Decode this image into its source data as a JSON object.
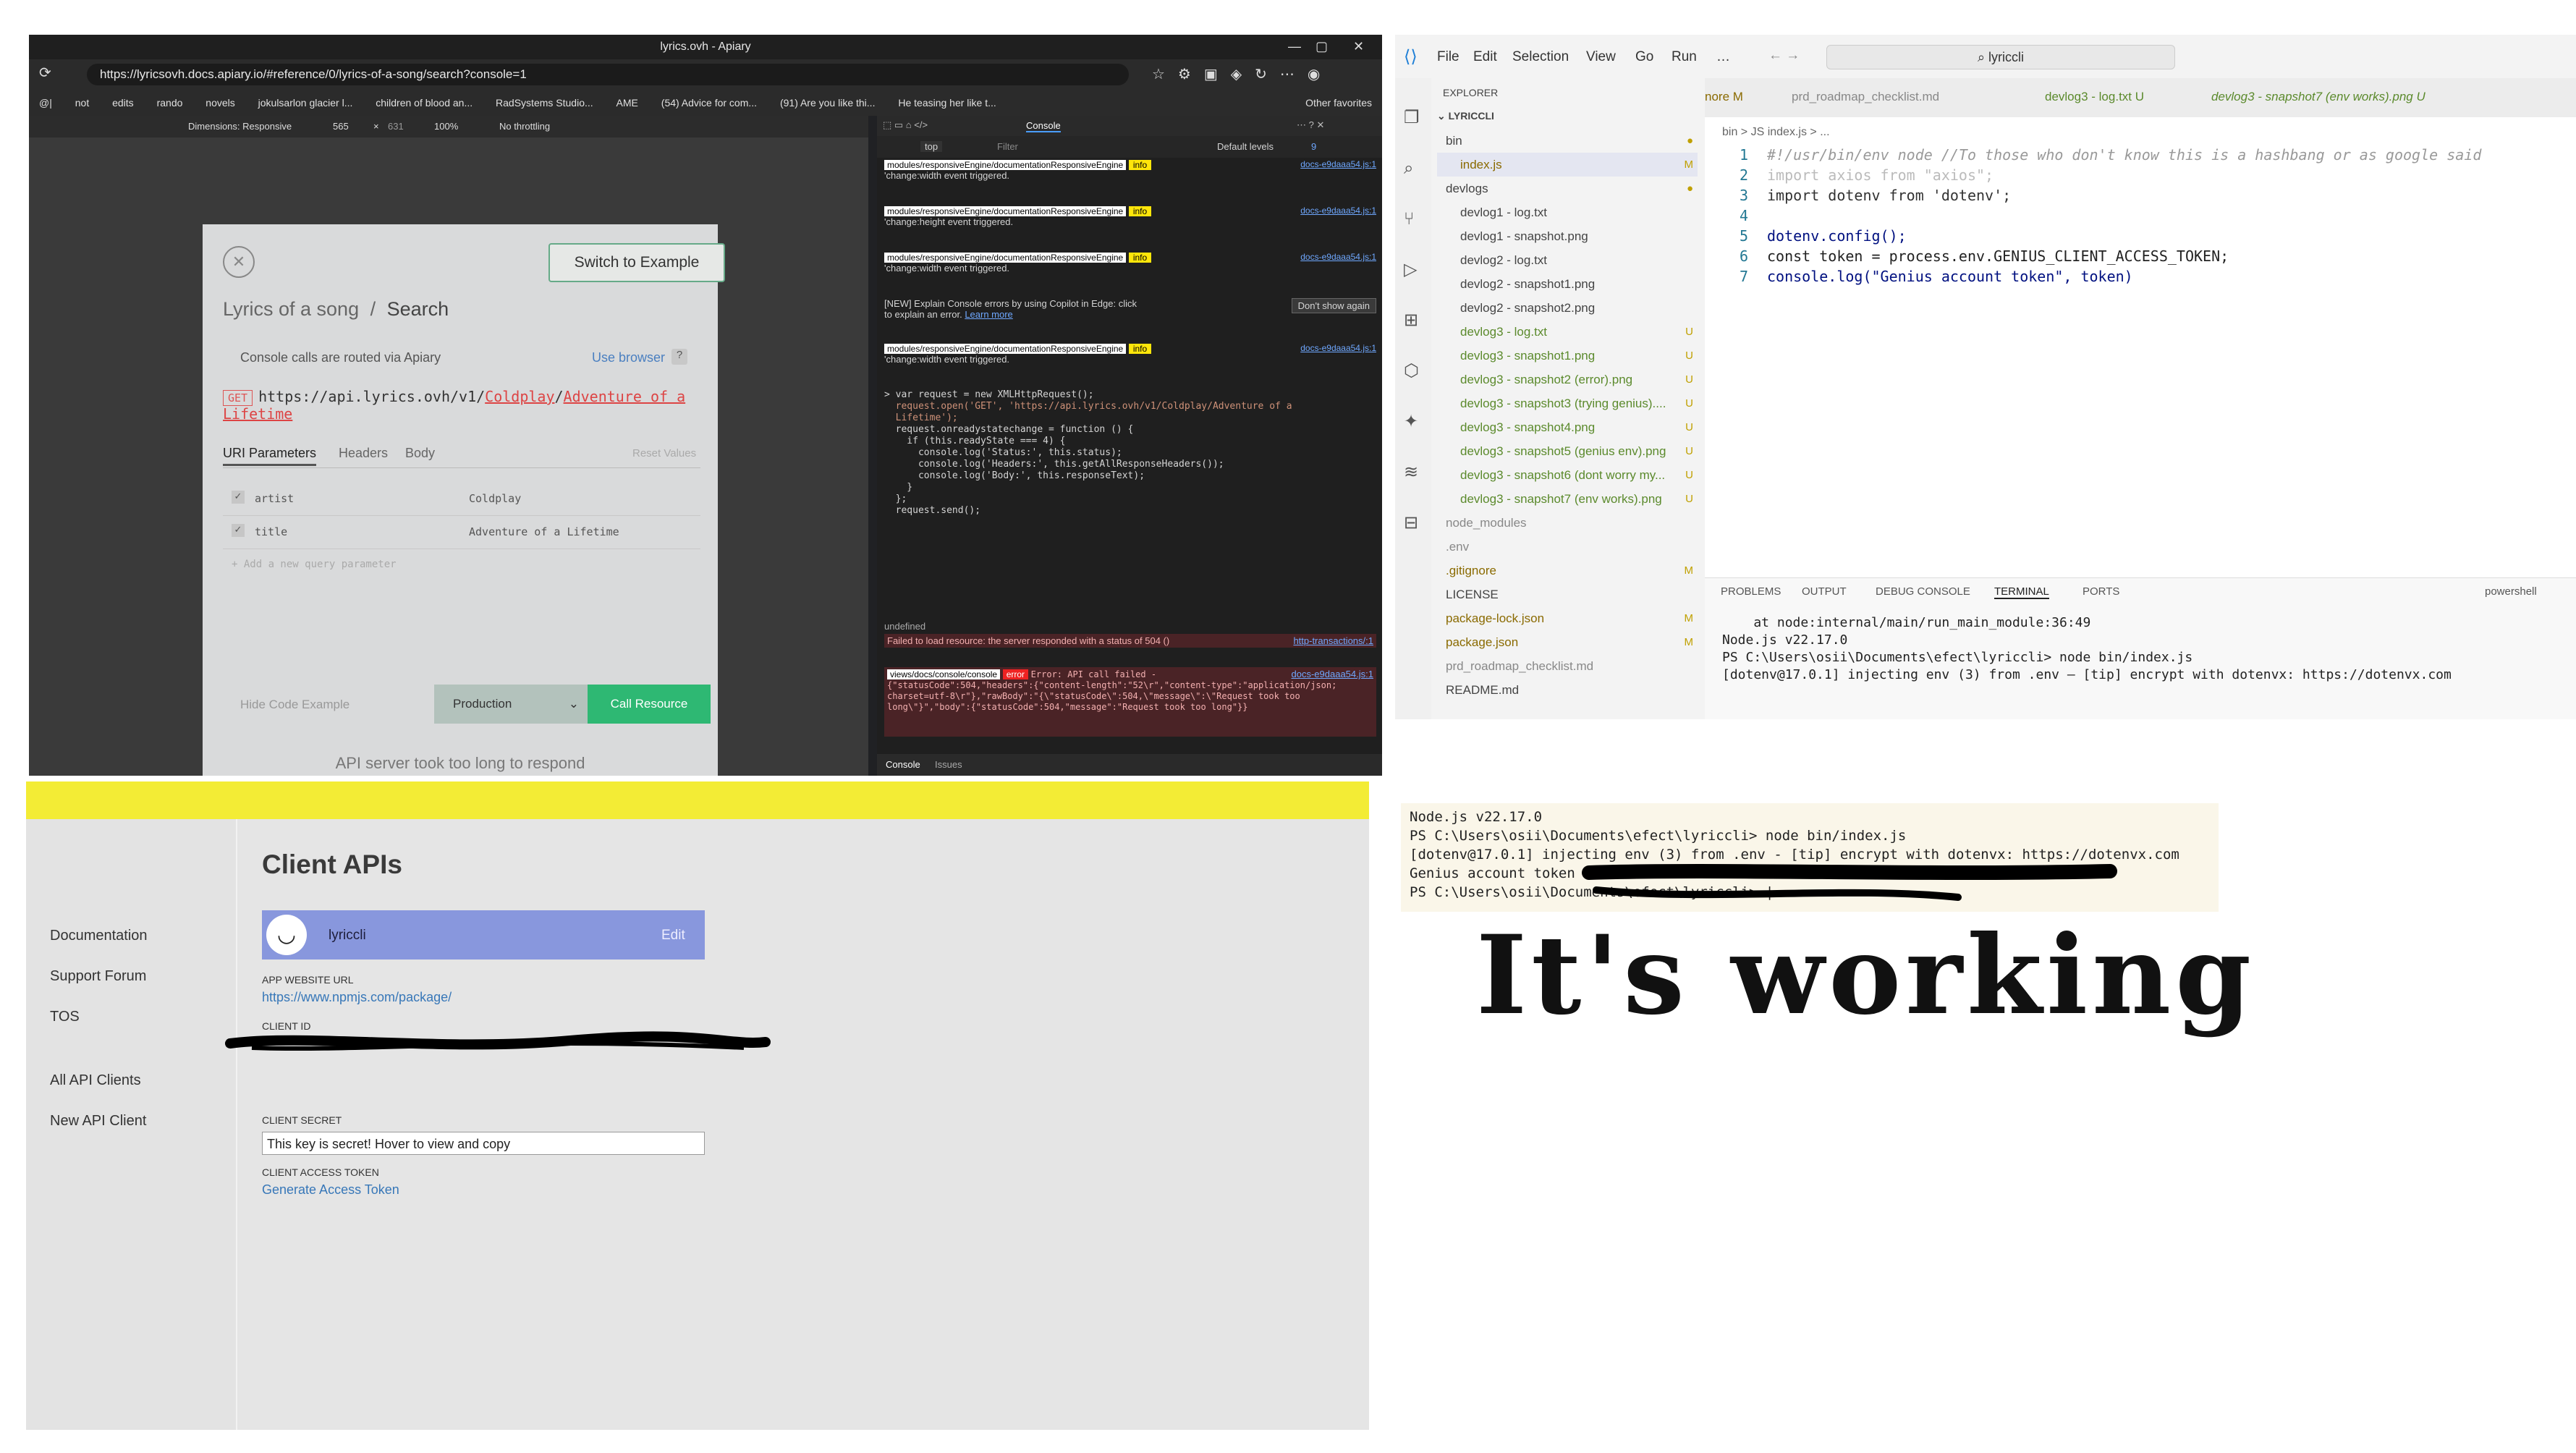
{
  "browser": {
    "window_title": "lyrics.ovh - Apiary",
    "url": "https://lyricsovh.docs.apiary.io/#reference/0/lyrics-of-a-song/search?console=1",
    "bookmarks": [
      "@|",
      "not",
      "edits",
      "rando",
      "novels",
      "jokulsarlon glacier l...",
      "children of blood an...",
      "RadSystems Studio...",
      "AME",
      "(54) Advice for com...",
      "(91) Are you like thi...",
      "He teasing her like t..."
    ],
    "other_favorites": "Other favorites",
    "devtoolbar": {
      "dimensions": "Dimensions: Responsive",
      "width": "565",
      "x": "×",
      "height": "631",
      "zoom": "100%",
      "throttle": "No throttling"
    }
  },
  "apiary": {
    "switch_label": "Switch to Example",
    "crumb_1": "Lyrics of a song",
    "crumb_sep": "/",
    "crumb_2": "Search",
    "routed_text": "Console calls are routed via Apiary",
    "use_browser": "Use browser",
    "method": "GET",
    "url_prefix": "https://api.lyrics.ovh/v1/",
    "url_artist": "Coldplay",
    "url_sep": "/",
    "url_title": "Adventure of a Lifetime",
    "tab_uri": "URI Parameters",
    "tab_headers": "Headers",
    "tab_body": "Body",
    "reset": "Reset Values",
    "params": [
      {
        "name": "artist",
        "value": "Coldplay"
      },
      {
        "name": "title",
        "value": "Adventure of a Lifetime"
      }
    ],
    "add_param": "Add a new query parameter",
    "hide_code": "Hide Code Example",
    "environment": "Production",
    "call_resource": "Call Resource",
    "error_message": "API server took too long to respond"
  },
  "devtools": {
    "console_tab": "Console",
    "context": "top",
    "filter_placeholder": "Filter",
    "levels": "Default levels",
    "issues_count": "9",
    "tag": "modules/responsiveEngine/documentationResponsiveEngine",
    "info": "info",
    "src": "docs-e9daaa54.js:1",
    "logs": [
      "'change:width event triggered.",
      "'change:height event triggered.",
      "'change:width event triggered.",
      "'change:width event triggered."
    ],
    "new_notice": "[NEW] Explain Console errors by using Copilot in Edge: click",
    "new_notice_2": "to explain an error.",
    "learn_more": "Learn more",
    "dont_show": "Don't show again",
    "code_lines": [
      "> var request = new XMLHttpRequest();",
      "",
      "  request.open('GET', 'https://api.lyrics.ovh/v1/Coldplay/Adventure of a",
      "  Lifetime');",
      "",
      "  request.onreadystatechange = function () {",
      "    if (this.readyState === 4) {",
      "      console.log('Status:', this.status);",
      "      console.log('Headers:', this.getAllResponseHeaders());",
      "      console.log('Body:', this.responseText);",
      "    }",
      "  };",
      "",
      "  request.send();"
    ],
    "undefined": "undefined",
    "fail_text": "Failed to load resource: the server responded with a status of 504 ()",
    "fail_link": "http-transactions/:1",
    "console_tag": "views/docs/console/console",
    "error_label": "error",
    "error_text": "Error: API call failed - {\"statusCode\":504,\"headers\":{\"content-length\":\"52\\r\",\"content-type\":\"application/json; charset=utf-8\\r\"},\"rawBody\":\"{\\\"statusCode\\\":504,\\\"message\\\":\\\"Request took too long\\\"}\",\"body\":{\"statusCode\":504,\"message\":\"Request took too long\"}}",
    "bottom_console": "Console",
    "bottom_issues": "Issues"
  },
  "vscode": {
    "menu": [
      "File",
      "Edit",
      "Selection",
      "View",
      "Go",
      "Run",
      "…"
    ],
    "search": "lyriccli",
    "tabs": [
      "nore M",
      "prd_roadmap_checklist.md",
      "devlog3 - log.txt U",
      "devlog3 - snapshot7 (env works).png U"
    ],
    "explorer_title": "EXPLORER",
    "root": "LYRICCLI",
    "files": [
      {
        "name": "bin",
        "status": ""
      },
      {
        "name": "index.js",
        "status": "M"
      },
      {
        "name": "devlogs",
        "status": ""
      },
      {
        "name": "devlog1 - log.txt",
        "status": ""
      },
      {
        "name": "devlog1 - snapshot.png",
        "status": ""
      },
      {
        "name": "devlog2 - log.txt",
        "status": ""
      },
      {
        "name": "devlog2 - snapshot1.png",
        "status": ""
      },
      {
        "name": "devlog2 - snapshot2.png",
        "status": ""
      },
      {
        "name": "devlog3 - log.txt",
        "status": "U"
      },
      {
        "name": "devlog3 - snapshot1.png",
        "status": "U"
      },
      {
        "name": "devlog3 - snapshot2 (error).png",
        "status": "U"
      },
      {
        "name": "devlog3 - snapshot3 (trying genius)....",
        "status": "U"
      },
      {
        "name": "devlog3 - snapshot4.png",
        "status": "U"
      },
      {
        "name": "devlog3 - snapshot5 (genius env).png",
        "status": "U"
      },
      {
        "name": "devlog3 - snapshot6 (dont worry my...",
        "status": "U"
      },
      {
        "name": "devlog3 - snapshot7 (env works).png",
        "status": "U"
      },
      {
        "name": "node_modules",
        "status": ""
      },
      {
        "name": ".env",
        "status": ""
      },
      {
        "name": ".gitignore",
        "status": "M"
      },
      {
        "name": "LICENSE",
        "status": ""
      },
      {
        "name": "package-lock.json",
        "status": "M"
      },
      {
        "name": "package.json",
        "status": "M"
      },
      {
        "name": "prd_roadmap_checklist.md",
        "status": ""
      },
      {
        "name": "README.md",
        "status": ""
      }
    ],
    "breadcrumb": "bin > JS index.js > ...",
    "code": [
      {
        "n": "1",
        "t": "#!/usr/bin/env node //To those who don't know this is a hashbang or as google said"
      },
      {
        "n": "2",
        "t": "import axios from \"axios\";"
      },
      {
        "n": "3",
        "t": "import dotenv from 'dotenv';"
      },
      {
        "n": "4",
        "t": ""
      },
      {
        "n": "5",
        "t": "dotenv.config();"
      },
      {
        "n": "6",
        "t": "const token = process.env.GENIUS_CLIENT_ACCESS_TOKEN;"
      },
      {
        "n": "7",
        "t": "console.log(\"Genius account token\", token)"
      }
    ],
    "panel_tabs": [
      "PROBLEMS",
      "OUTPUT",
      "DEBUG CONSOLE",
      "TERMINAL",
      "PORTS"
    ],
    "shell": "powershell",
    "terminal": [
      "    at node:internal/main/run_main_module:36:49",
      "",
      "Node.js v22.17.0",
      "PS C:\\Users\\osii\\Documents\\efect\\lyriccli> node bin/index.js",
      "[dotenv@17.0.1] injecting env (3) from .env – [tip] encrypt with dotenvx: https://dotenvx.com"
    ]
  },
  "client": {
    "title": "Client APIs",
    "nav": [
      "Documentation",
      "Support Forum",
      "TOS",
      "All API Clients",
      "New API Client"
    ],
    "app_name": "lyriccli",
    "edit": "Edit",
    "app_url_label": "APP WEBSITE URL",
    "app_url": "https://www.npmjs.com/package/",
    "client_id_label": "CLIENT ID",
    "client_secret_label": "CLIENT SECRET",
    "secret_placeholder": "This key is secret! Hover to view and copy",
    "token_label": "CLIENT ACCESS TOKEN",
    "generate_token": "Generate Access Token"
  },
  "snippet": {
    "lines": [
      "Node.js v22.17.0",
      "PS C:\\Users\\osii\\Documents\\efect\\lyriccli> node bin/index.js",
      "[dotenv@17.0.1] injecting env (3) from .env - [tip] encrypt with dotenvx: https://dotenvx.com",
      "Genius account token",
      "PS C:\\Users\\osii\\Documents\\efect\\lyriccli> |"
    ]
  },
  "handwritten": "It's working"
}
